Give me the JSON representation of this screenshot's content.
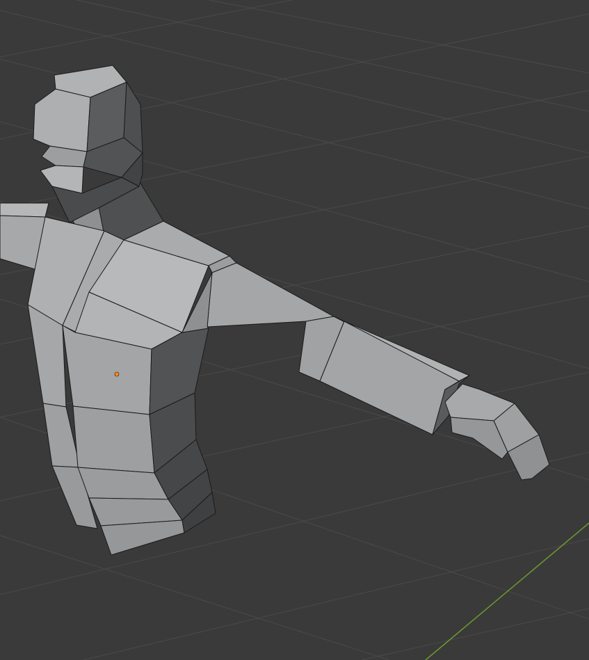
{
  "viewport": {
    "mode": "3d-viewport",
    "background_color": "#3a3a3a",
    "grid_color": "#4a4a4a",
    "x_axis_color": "#6f9a2e",
    "origin_color": "#ff8a1c"
  },
  "object": {
    "kind": "low-poly humanoid mesh",
    "shading": "solid",
    "face_colors": {
      "light": "#b2b4b5",
      "mid": "#9c9e9f",
      "dark": "#5b5c5d",
      "darker": "#444546"
    }
  }
}
